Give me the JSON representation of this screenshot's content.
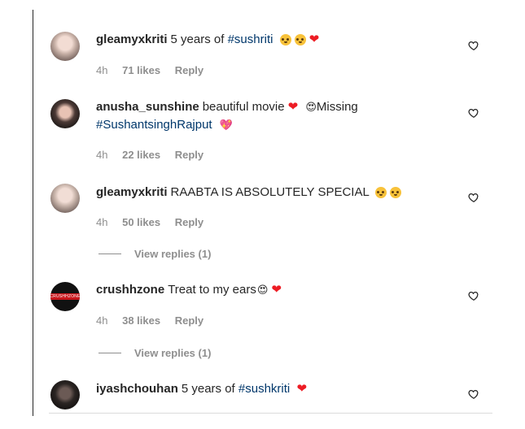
{
  "comments": [
    {
      "username": "gleamyxkriti",
      "text_parts": [
        "5 years of ",
        "#sushriti"
      ],
      "time": "4h",
      "likes": "71 likes",
      "reply": "Reply"
    },
    {
      "username": "anusha_sunshine",
      "text_parts": [
        "beautiful movie",
        "Missing",
        "#SushantsinghRajput"
      ],
      "time": "4h",
      "likes": "22 likes",
      "reply": "Reply"
    },
    {
      "username": "gleamyxkriti",
      "text_parts": [
        "RAABTA IS ABSOLUTELY SPECIAL"
      ],
      "time": "4h",
      "likes": "50 likes",
      "reply": "Reply",
      "view_replies": "View replies (1)"
    },
    {
      "username": "crushhzone",
      "text_parts": [
        "Treat to my ears"
      ],
      "time": "4h",
      "likes": "38 likes",
      "reply": "Reply",
      "view_replies": "View replies (1)",
      "avatar_badge": "CRUSHHZONE"
    },
    {
      "username": "iyashchouhan",
      "text_parts": [
        "5 years of ",
        "#sushkriti"
      ]
    }
  ],
  "icons": {
    "like": "heart-outline-icon",
    "pleading": "pleading-face-emoji",
    "red_heart": "red-heart-emoji",
    "heart_eyes": "heart-eyes-emoji",
    "sparkling_heart": "sparkling-heart-emoji"
  },
  "colors": {
    "hashtag": "#00376b",
    "meta": "#8e8e8e",
    "heart": "#ed1c24"
  }
}
